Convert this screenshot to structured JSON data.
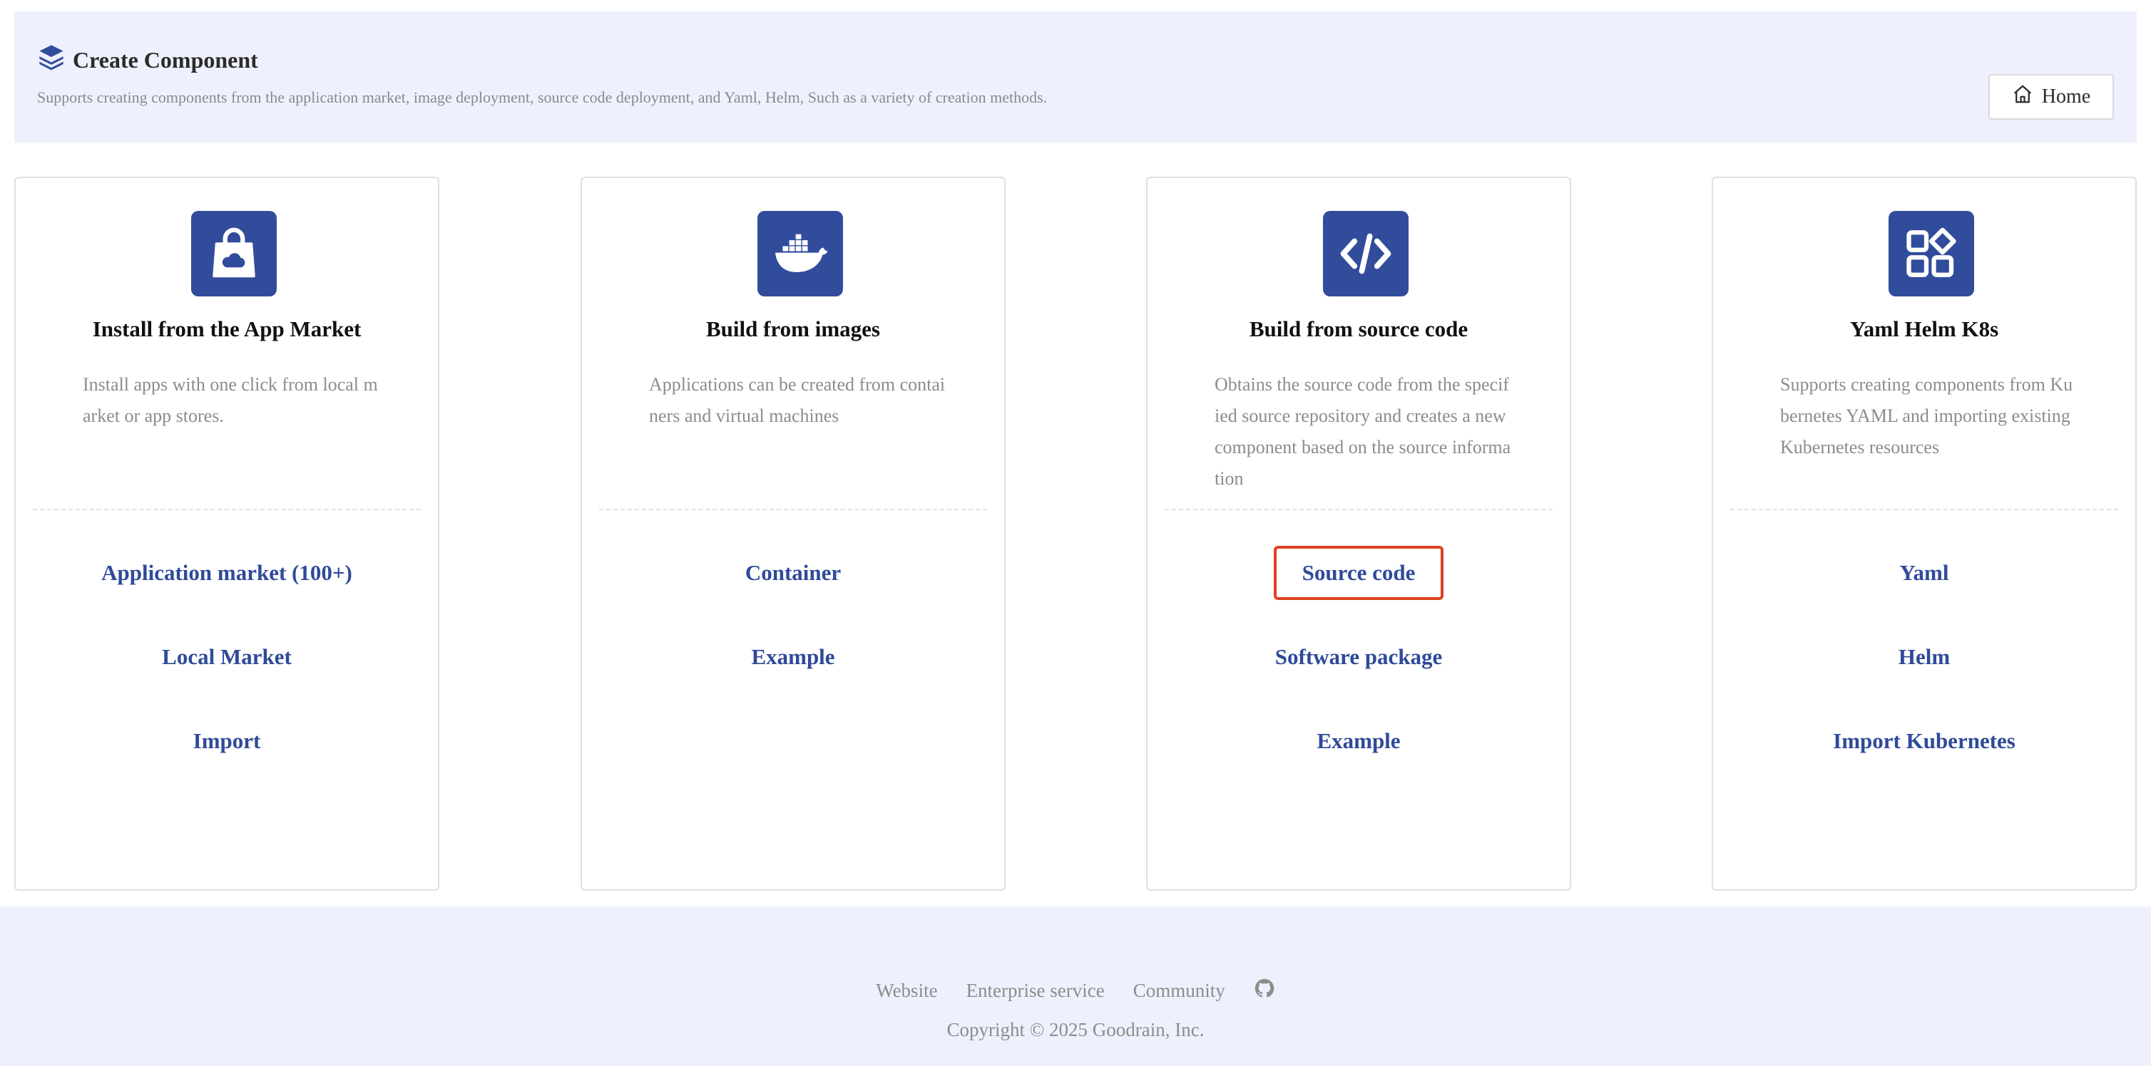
{
  "header": {
    "title": "Create Component",
    "description": "Supports creating components from the application market, image deployment, source code deployment, and Yaml, Helm, Such as a variety of creation methods.",
    "home_label": "Home",
    "title_icon": "layers-icon",
    "home_icon": "home-icon"
  },
  "cards": [
    {
      "icon": "shopping-bag-cloud-icon",
      "title": "Install from the App Market",
      "description": "Install apps with one click from local market or app stores.",
      "links": [
        "Application market (100+)",
        "Local Market",
        "Import"
      ]
    },
    {
      "icon": "docker-whale-icon",
      "title": "Build from images",
      "description": "Applications can be created from containers and virtual machines",
      "links": [
        "Container",
        "Example"
      ]
    },
    {
      "icon": "code-brackets-icon",
      "title": "Build from source code",
      "description": "Obtains the source code from the specified source repository and creates a new component based on the source information",
      "links": [
        "Source code",
        "Software package",
        "Example"
      ]
    },
    {
      "icon": "app-grid-icon",
      "title": "Yaml Helm K8s",
      "description": "Supports creating components from Kubernetes YAML and importing existing Kubernetes resources",
      "links": [
        "Yaml",
        "Helm",
        "Import Kubernetes"
      ]
    }
  ],
  "footer": {
    "links": [
      "Website",
      "Enterprise service",
      "Community"
    ],
    "github_icon": "github-icon",
    "copyright": "Copyright © 2025 Goodrain, Inc."
  },
  "colors": {
    "accent": "#324c9c",
    "link": "#2f4a99",
    "highlight": "#e0401e",
    "header_bg": "#eef1fd"
  }
}
